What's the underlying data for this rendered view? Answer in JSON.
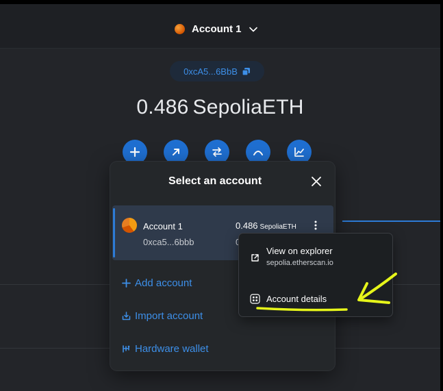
{
  "header": {
    "account_name": "Account 1"
  },
  "wallet": {
    "address_short": "0xcA5...6BbB",
    "balance_amount": "0.486",
    "balance_unit": "SepoliaETH",
    "actions": [
      {
        "name": "buy",
        "icon": "plus-icon"
      },
      {
        "name": "send",
        "icon": "arrow-up-right-icon"
      },
      {
        "name": "swap",
        "icon": "swap-icon"
      },
      {
        "name": "bridge",
        "icon": "bridge-icon"
      },
      {
        "name": "portfolio",
        "icon": "chart-icon"
      }
    ]
  },
  "modal": {
    "title": "Select an account",
    "accounts": [
      {
        "name": "Account 1",
        "address": "0xca5...6bbb",
        "balance_amount": "0.486",
        "balance_unit": "SepoliaETH",
        "balance_fiat_partial": "0"
      }
    ],
    "options": {
      "add_account": "Add account",
      "import_account": "Import account",
      "hardware_wallet": "Hardware wallet"
    }
  },
  "account_menu": {
    "view_on_explorer": "View on explorer",
    "explorer_domain": "sepolia.etherscan.io",
    "account_details": "Account details"
  },
  "colors": {
    "accent": "#3d8fe8",
    "button_blue": "#1f6fd1",
    "annotation_yellow": "#e6f51a"
  }
}
